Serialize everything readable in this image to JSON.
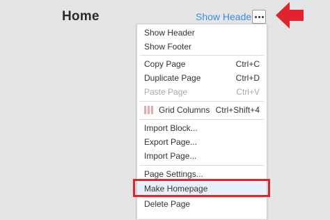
{
  "header": {
    "title": "Home",
    "show_header_link": "Show Header",
    "more_button_icon": "ellipsis-icon"
  },
  "menu": {
    "items": [
      {
        "label": "Show Header",
        "shortcut": "",
        "disabled": false
      },
      {
        "label": "Show Footer",
        "shortcut": "",
        "disabled": false
      },
      {
        "label": "Copy Page",
        "shortcut": "Ctrl+C",
        "disabled": false
      },
      {
        "label": "Duplicate Page",
        "shortcut": "Ctrl+D",
        "disabled": false
      },
      {
        "label": "Paste Page",
        "shortcut": "Ctrl+V",
        "disabled": true
      },
      {
        "label": "Grid Columns",
        "shortcut": "Ctrl+Shift+4",
        "disabled": false,
        "icon": "grid-columns-icon"
      },
      {
        "label": "Import Block...",
        "shortcut": "",
        "disabled": false
      },
      {
        "label": "Export Page...",
        "shortcut": "",
        "disabled": false
      },
      {
        "label": "Import Page...",
        "shortcut": "",
        "disabled": false
      },
      {
        "label": "Page Settings...",
        "shortcut": "",
        "disabled": false
      },
      {
        "label": "Make Homepage",
        "shortcut": "",
        "disabled": false,
        "highlighted": true
      },
      {
        "label": "Delete Page",
        "shortcut": "",
        "disabled": false
      }
    ]
  },
  "colors": {
    "background": "#e5e5e5",
    "link": "#3a8ee6",
    "annotation_red": "#e1232e",
    "highlight_bg": "#e8f1fb",
    "grid_icon": "#f2a5a5"
  },
  "annotation": {
    "arrow_icon": "red-arrow-left-icon"
  }
}
